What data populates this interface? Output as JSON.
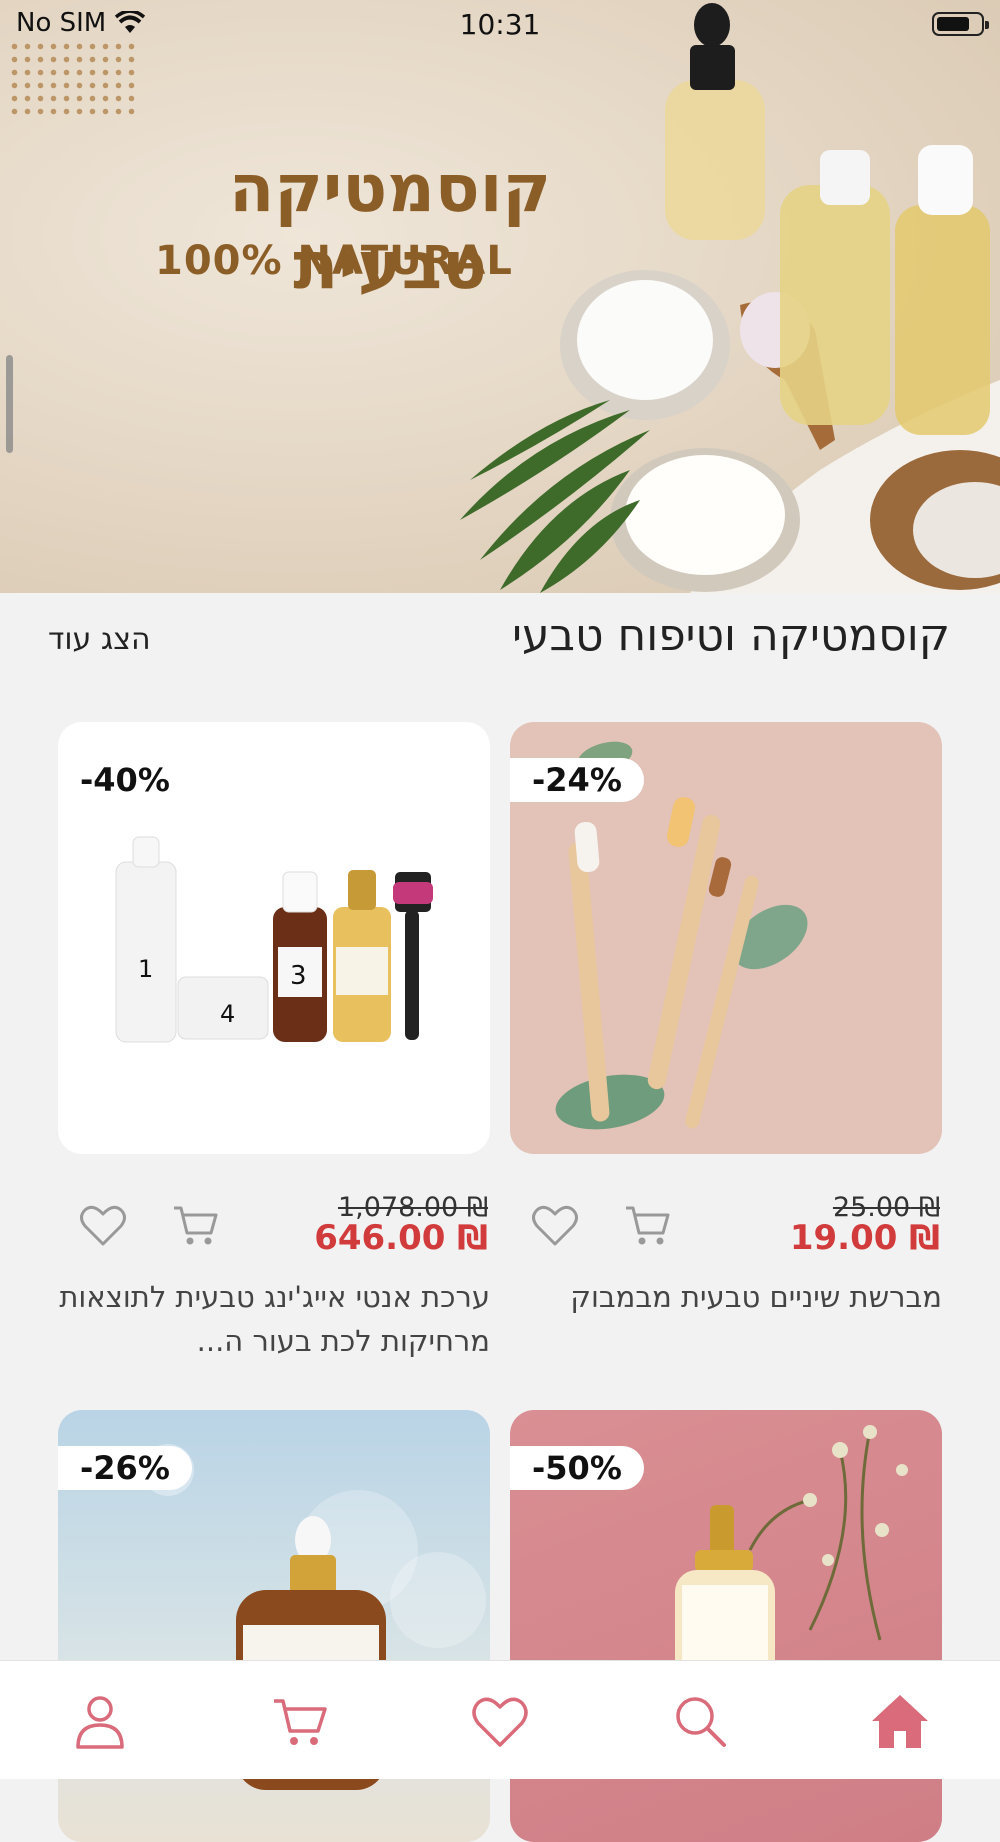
{
  "status_bar": {
    "carrier": "No SIM",
    "time": "10:31"
  },
  "banner": {
    "title": "קוסמטיקה טבעית",
    "subtitle": "100%  NATURAL"
  },
  "section": {
    "title": "קוסמטיקה וטיפוח טבעי",
    "show_more": "הצג עוד"
  },
  "products": [
    {
      "discount": "-24%",
      "old_price": "₪ 25.00",
      "price": "₪ 19.00",
      "name": "מברשת שיניים טבעית מבמבוק"
    },
    {
      "discount": "-40%",
      "old_price": "₪ 1,078.00",
      "price": "₪ 646.00",
      "name": "ערכת אנטי אייג'ינג טבעית לתוצאות מרחיקות לכת בעור ה..."
    },
    {
      "discount": "-50%"
    },
    {
      "discount": "-26%"
    }
  ],
  "bottom_nav": [
    "home-icon",
    "search-icon",
    "heart-icon",
    "cart-icon",
    "user-icon"
  ],
  "colors": {
    "accent": "#d96b7a",
    "price": "#d23b3b",
    "banner_text": "#8b5e27"
  }
}
